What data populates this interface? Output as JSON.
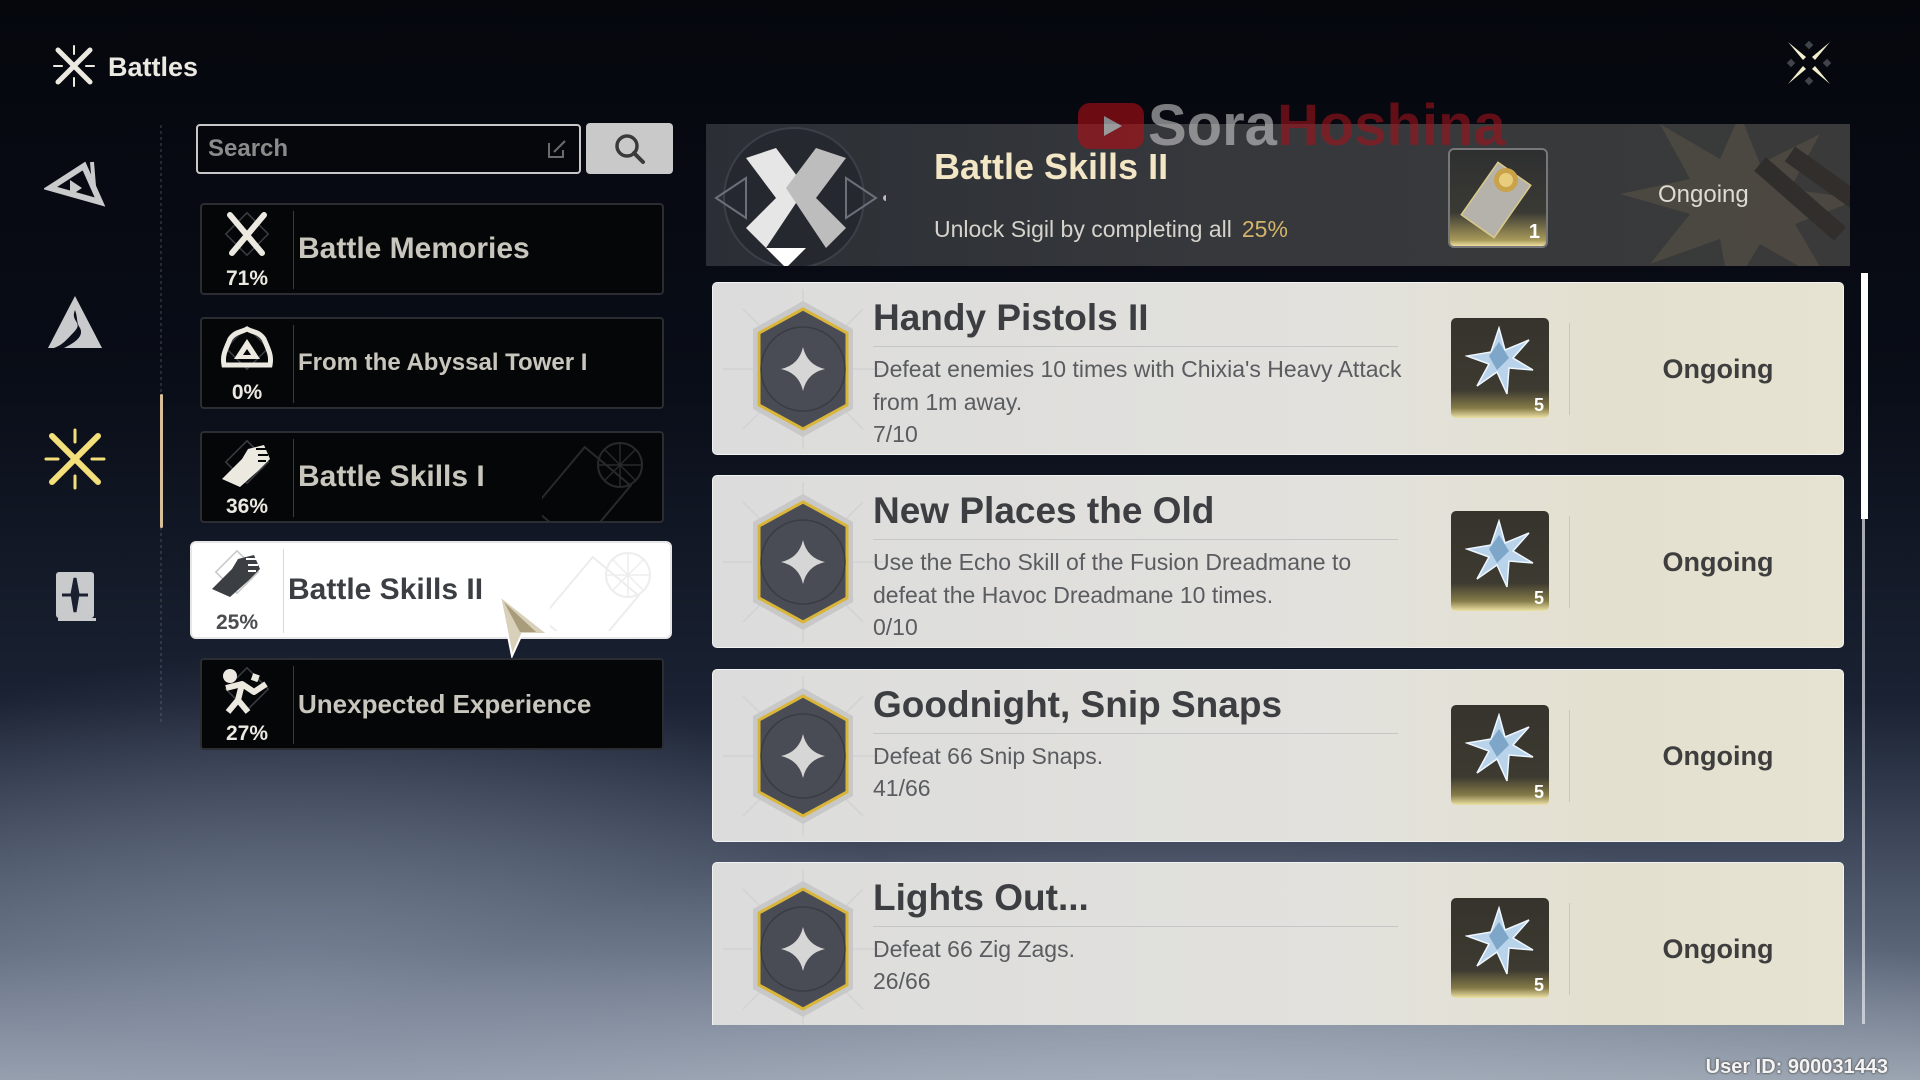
{
  "header": {
    "title": "Battles",
    "title_icon": "crossed-swords-icon",
    "close_icon": "close-icon"
  },
  "nav": {
    "items": [
      {
        "name": "echo-triangle",
        "icon": "triangle-emblem-icon",
        "active": false
      },
      {
        "name": "exploration",
        "icon": "mountain-icon",
        "active": false
      },
      {
        "name": "battles",
        "icon": "crossed-swords-icon",
        "active": true
      },
      {
        "name": "collection",
        "icon": "book-icon",
        "active": false
      }
    ],
    "active_color": "#f3e07a"
  },
  "search": {
    "placeholder": "Search",
    "value": "",
    "edit_icon": "edit-icon",
    "button_icon": "search-icon"
  },
  "categories": [
    {
      "label": "Battle Memories",
      "percent": "71%",
      "icon": "crossed-swords-icon",
      "selected": false
    },
    {
      "label": "From the Abyssal Tower I",
      "percent": "0%",
      "icon": "tower-triangle-icon",
      "selected": false
    },
    {
      "label": "Battle Skills I",
      "percent": "36%",
      "icon": "fist-icon",
      "selected": false
    },
    {
      "label": "Battle Skills II",
      "percent": "25%",
      "icon": "fist-icon",
      "selected": true
    },
    {
      "label": "Unexpected Experience",
      "percent": "27%",
      "icon": "falling-figure-icon",
      "selected": false
    }
  ],
  "banner": {
    "title": "Battle Skills II",
    "subtitle": "Unlock Sigil by completing all",
    "percent": "25%",
    "reward_quantity": "1",
    "reward_icon": "sigil-card-icon",
    "status": "Ongoing",
    "accent_color": "#d4b46a"
  },
  "achievements": [
    {
      "title": "Handy Pistols II",
      "description": "Defeat enemies 10 times with Chixia's Heavy Attack from 1m away.",
      "progress": "7/10",
      "reward_quantity": "5",
      "reward_icon": "astrite-icon",
      "status": "Ongoing"
    },
    {
      "title": "New Places the Old",
      "description": "Use the Echo Skill of the Fusion Dreadmane to defeat the Havoc Dreadmane 10 times.",
      "progress": "0/10",
      "reward_quantity": "5",
      "reward_icon": "astrite-icon",
      "status": "Ongoing"
    },
    {
      "title": "Goodnight, Snip Snaps",
      "description": "Defeat 66 Snip Snaps.",
      "progress": "41/66",
      "reward_quantity": "5",
      "reward_icon": "astrite-icon",
      "status": "Ongoing"
    },
    {
      "title": "Lights Out...",
      "description": "Defeat 66 Zig Zags.",
      "progress": "26/66",
      "reward_quantity": "5",
      "reward_icon": "astrite-icon",
      "status": "Ongoing"
    }
  ],
  "watermark": {
    "part1": "Sora",
    "part2": "Hoshina"
  },
  "footer": {
    "user_id": "User ID: 900031443"
  }
}
